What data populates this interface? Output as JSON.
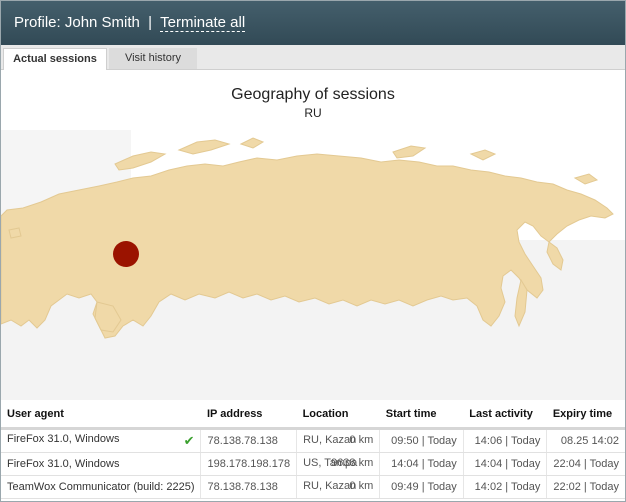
{
  "header": {
    "profile_label": "Profile: John Smith",
    "separator": "|",
    "terminate_all": "Terminate all"
  },
  "tabs": [
    {
      "label": "Actual sessions",
      "active": true
    },
    {
      "label": "Visit history",
      "active": false
    }
  ],
  "map": {
    "title": "Geography of sessions",
    "subtitle": "RU",
    "land_color": "#f0d9a8",
    "water_color": "#f3f3f3",
    "marker_color": "#9b1300"
  },
  "table": {
    "columns": [
      "User agent",
      "IP address",
      "Location",
      "Start time",
      "Last activity",
      "Expiry time"
    ],
    "rows": [
      {
        "agent": "FireFox 31.0, Windows",
        "current": true,
        "ip": "78.138.78.138",
        "location": "RU, Kazan",
        "distance": "0 km",
        "start": "09:50 | Today",
        "last": "14:06 | Today",
        "expiry": "08.25 14:02"
      },
      {
        "agent": "FireFox 31.0, Windows",
        "current": false,
        "ip": "198.178.198.178",
        "location": "US, Tampa",
        "distance": "9638 km",
        "start": "14:04 | Today",
        "last": "14:04 | Today",
        "expiry": "22:04 | Today"
      },
      {
        "agent": "TeamWox Communicator (build: 2225)",
        "current": false,
        "ip": "78.138.78.138",
        "location": "RU, Kazan",
        "distance": "0 km",
        "start": "09:49 | Today",
        "last": "14:02 | Today",
        "expiry": "22:02 | Today"
      }
    ]
  }
}
